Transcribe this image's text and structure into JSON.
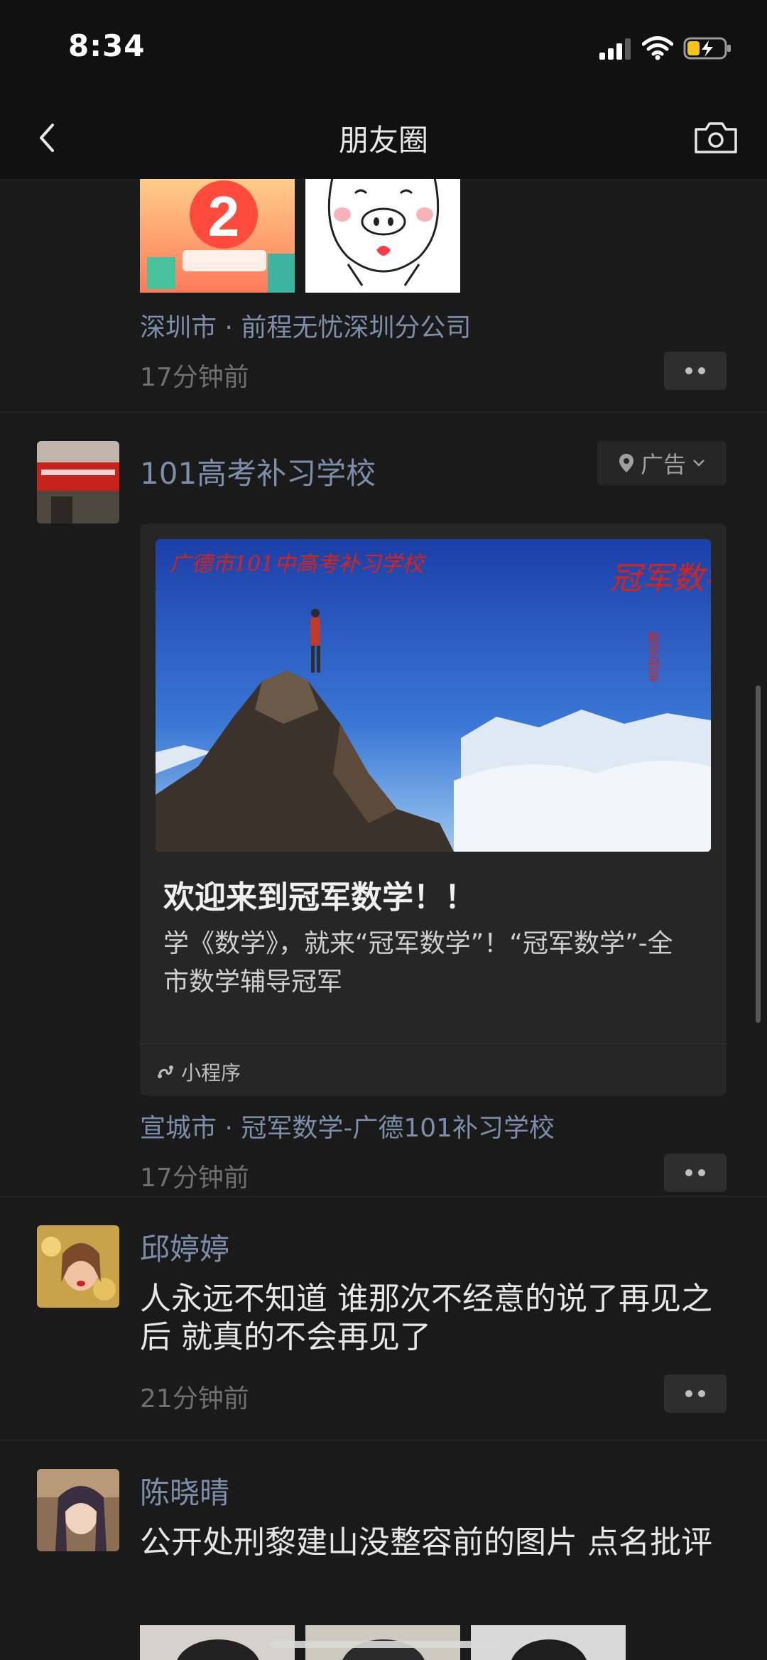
{
  "status_bar": {
    "time": "8:34"
  },
  "nav": {
    "title": "朋友圈"
  },
  "posts": [
    {
      "location": "深圳市 · 前程无忧深圳分公司",
      "time": "17分钟前"
    },
    {
      "name": "101高考补习学校",
      "ad_label": "广告",
      "card_image_text": {
        "school": "广德市101中高考补习学校",
        "calligraphy": "冠军数学",
        "vertical": "数学冠军"
      },
      "card_title": "欢迎来到冠军数学！！",
      "card_desc": "学《数学》，就来“冠军数学”！“冠军数学”-全市数学辅导冠军",
      "mini_program": "小程序",
      "location": "宣城市 · 冠军数学-广德101补习学校",
      "time": "17分钟前"
    },
    {
      "name": "邱婷婷",
      "text": "人永远不知道 谁那次不经意的说了再见之后 就真的不会再见了",
      "time": "21分钟前"
    },
    {
      "name": "陈晓晴",
      "text": "公开处刑黎建山没整容前的图片 点名批评"
    }
  ]
}
